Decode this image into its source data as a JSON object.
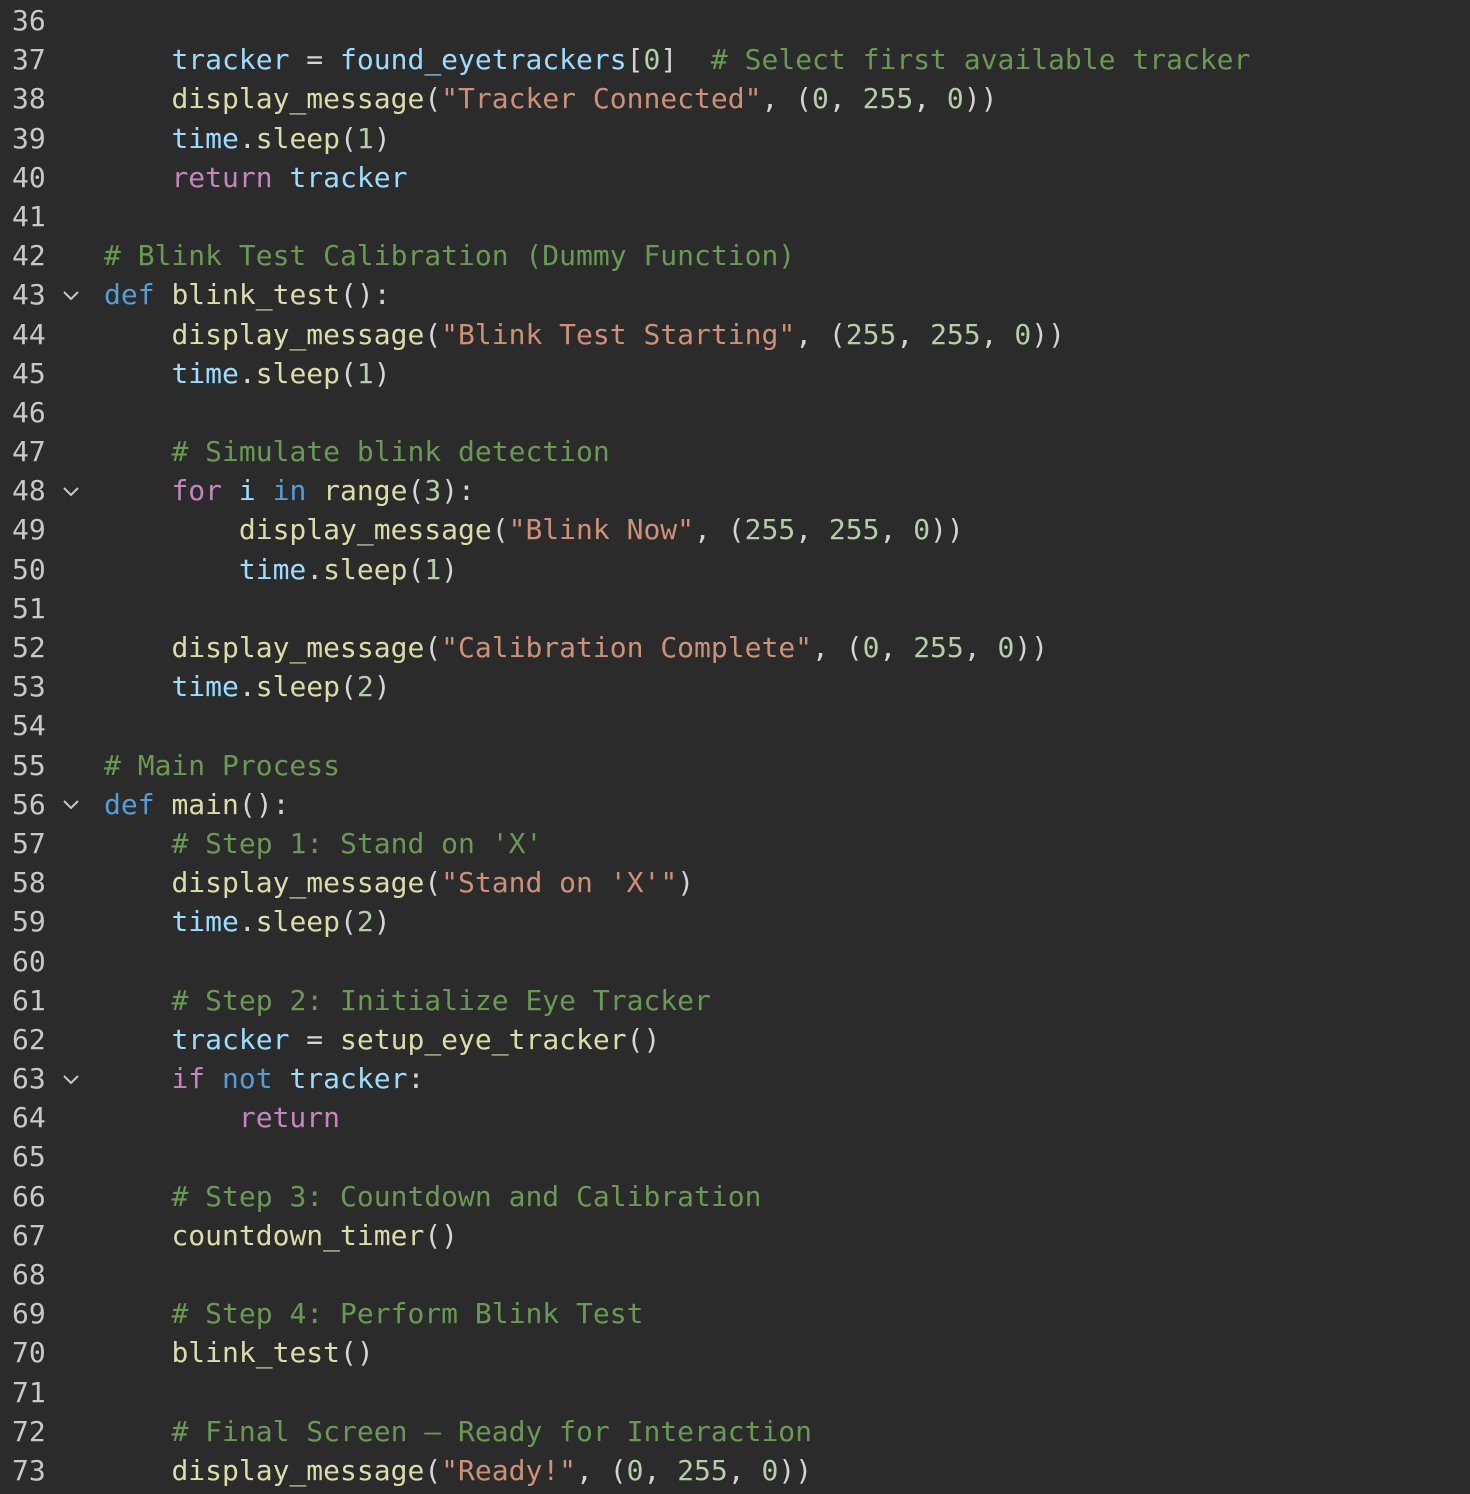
{
  "editor": {
    "language": "python",
    "theme": {
      "background": "#2b2b2b",
      "line_number": "#c8c8c8",
      "keyword": "#569cd6",
      "control": "#c586c0",
      "function": "#dcdcaa",
      "variable": "#9cdcfe",
      "string": "#ce9178",
      "number": "#b5cea8",
      "comment": "#6a9955",
      "plain": "#d4d4d4"
    },
    "fold_icon": "chevron-down-icon",
    "lines": [
      {
        "num": "36",
        "indent": 0,
        "fold": false,
        "tokens": []
      },
      {
        "num": "37",
        "indent": 1,
        "fold": false,
        "tokens": [
          [
            "var",
            "tracker"
          ],
          [
            "plain",
            " = "
          ],
          [
            "var",
            "found_eyetrackers"
          ],
          [
            "plain",
            "["
          ],
          [
            "num",
            "0"
          ],
          [
            "plain",
            "]  "
          ],
          [
            "com",
            "# Select first available tracker"
          ]
        ]
      },
      {
        "num": "38",
        "indent": 1,
        "fold": false,
        "tokens": [
          [
            "fn",
            "display_message"
          ],
          [
            "plain",
            "("
          ],
          [
            "str",
            "\"Tracker Connected\""
          ],
          [
            "plain",
            ", ("
          ],
          [
            "num",
            "0"
          ],
          [
            "plain",
            ", "
          ],
          [
            "num",
            "255"
          ],
          [
            "plain",
            ", "
          ],
          [
            "num",
            "0"
          ],
          [
            "plain",
            "))"
          ]
        ]
      },
      {
        "num": "39",
        "indent": 1,
        "fold": false,
        "tokens": [
          [
            "var",
            "time"
          ],
          [
            "plain",
            "."
          ],
          [
            "fn",
            "sleep"
          ],
          [
            "plain",
            "("
          ],
          [
            "num",
            "1"
          ],
          [
            "plain",
            ")"
          ]
        ]
      },
      {
        "num": "40",
        "indent": 1,
        "fold": false,
        "tokens": [
          [
            "ctrl",
            "return"
          ],
          [
            "plain",
            " "
          ],
          [
            "var",
            "tracker"
          ]
        ]
      },
      {
        "num": "41",
        "indent": 0,
        "fold": false,
        "tokens": []
      },
      {
        "num": "42",
        "indent": 0,
        "fold": false,
        "tokens": [
          [
            "com",
            "# Blink Test Calibration (Dummy Function)"
          ]
        ]
      },
      {
        "num": "43",
        "indent": 0,
        "fold": true,
        "tokens": [
          [
            "kw",
            "def"
          ],
          [
            "plain",
            " "
          ],
          [
            "fn",
            "blink_test"
          ],
          [
            "plain",
            "():"
          ]
        ]
      },
      {
        "num": "44",
        "indent": 1,
        "fold": false,
        "tokens": [
          [
            "fn",
            "display_message"
          ],
          [
            "plain",
            "("
          ],
          [
            "str",
            "\"Blink Test Starting\""
          ],
          [
            "plain",
            ", ("
          ],
          [
            "num",
            "255"
          ],
          [
            "plain",
            ", "
          ],
          [
            "num",
            "255"
          ],
          [
            "plain",
            ", "
          ],
          [
            "num",
            "0"
          ],
          [
            "plain",
            "))"
          ]
        ]
      },
      {
        "num": "45",
        "indent": 1,
        "fold": false,
        "tokens": [
          [
            "var",
            "time"
          ],
          [
            "plain",
            "."
          ],
          [
            "fn",
            "sleep"
          ],
          [
            "plain",
            "("
          ],
          [
            "num",
            "1"
          ],
          [
            "plain",
            ")"
          ]
        ]
      },
      {
        "num": "46",
        "indent": 0,
        "fold": false,
        "tokens": []
      },
      {
        "num": "47",
        "indent": 1,
        "fold": false,
        "tokens": [
          [
            "com",
            "# Simulate blink detection"
          ]
        ]
      },
      {
        "num": "48",
        "indent": 1,
        "fold": true,
        "tokens": [
          [
            "ctrl",
            "for"
          ],
          [
            "plain",
            " "
          ],
          [
            "var",
            "i"
          ],
          [
            "plain",
            " "
          ],
          [
            "kw",
            "in"
          ],
          [
            "plain",
            " "
          ],
          [
            "fn",
            "range"
          ],
          [
            "plain",
            "("
          ],
          [
            "num",
            "3"
          ],
          [
            "plain",
            "):"
          ]
        ]
      },
      {
        "num": "49",
        "indent": 2,
        "fold": false,
        "tokens": [
          [
            "fn",
            "display_message"
          ],
          [
            "plain",
            "("
          ],
          [
            "str",
            "\"Blink Now\""
          ],
          [
            "plain",
            ", ("
          ],
          [
            "num",
            "255"
          ],
          [
            "plain",
            ", "
          ],
          [
            "num",
            "255"
          ],
          [
            "plain",
            ", "
          ],
          [
            "num",
            "0"
          ],
          [
            "plain",
            "))"
          ]
        ]
      },
      {
        "num": "50",
        "indent": 2,
        "fold": false,
        "tokens": [
          [
            "var",
            "time"
          ],
          [
            "plain",
            "."
          ],
          [
            "fn",
            "sleep"
          ],
          [
            "plain",
            "("
          ],
          [
            "num",
            "1"
          ],
          [
            "plain",
            ")"
          ]
        ]
      },
      {
        "num": "51",
        "indent": 0,
        "fold": false,
        "tokens": []
      },
      {
        "num": "52",
        "indent": 1,
        "fold": false,
        "tokens": [
          [
            "fn",
            "display_message"
          ],
          [
            "plain",
            "("
          ],
          [
            "str",
            "\"Calibration Complete\""
          ],
          [
            "plain",
            ", ("
          ],
          [
            "num",
            "0"
          ],
          [
            "plain",
            ", "
          ],
          [
            "num",
            "255"
          ],
          [
            "plain",
            ", "
          ],
          [
            "num",
            "0"
          ],
          [
            "plain",
            "))"
          ]
        ]
      },
      {
        "num": "53",
        "indent": 1,
        "fold": false,
        "tokens": [
          [
            "var",
            "time"
          ],
          [
            "plain",
            "."
          ],
          [
            "fn",
            "sleep"
          ],
          [
            "plain",
            "("
          ],
          [
            "num",
            "2"
          ],
          [
            "plain",
            ")"
          ]
        ]
      },
      {
        "num": "54",
        "indent": 0,
        "fold": false,
        "tokens": []
      },
      {
        "num": "55",
        "indent": 0,
        "fold": false,
        "tokens": [
          [
            "com",
            "# Main Process"
          ]
        ]
      },
      {
        "num": "56",
        "indent": 0,
        "fold": true,
        "tokens": [
          [
            "kw",
            "def"
          ],
          [
            "plain",
            " "
          ],
          [
            "fn",
            "main"
          ],
          [
            "plain",
            "():"
          ]
        ]
      },
      {
        "num": "57",
        "indent": 1,
        "fold": false,
        "tokens": [
          [
            "com",
            "# Step 1: Stand on 'X'"
          ]
        ]
      },
      {
        "num": "58",
        "indent": 1,
        "fold": false,
        "tokens": [
          [
            "fn",
            "display_message"
          ],
          [
            "plain",
            "("
          ],
          [
            "str",
            "\"Stand on 'X'\""
          ],
          [
            "plain",
            ")"
          ]
        ]
      },
      {
        "num": "59",
        "indent": 1,
        "fold": false,
        "tokens": [
          [
            "var",
            "time"
          ],
          [
            "plain",
            "."
          ],
          [
            "fn",
            "sleep"
          ],
          [
            "plain",
            "("
          ],
          [
            "num",
            "2"
          ],
          [
            "plain",
            ")"
          ]
        ]
      },
      {
        "num": "60",
        "indent": 0,
        "fold": false,
        "tokens": []
      },
      {
        "num": "61",
        "indent": 1,
        "fold": false,
        "tokens": [
          [
            "com",
            "# Step 2: Initialize Eye Tracker"
          ]
        ]
      },
      {
        "num": "62",
        "indent": 1,
        "fold": false,
        "tokens": [
          [
            "var",
            "tracker"
          ],
          [
            "plain",
            " = "
          ],
          [
            "fn",
            "setup_eye_tracker"
          ],
          [
            "plain",
            "()"
          ]
        ]
      },
      {
        "num": "63",
        "indent": 1,
        "fold": true,
        "tokens": [
          [
            "ctrl",
            "if"
          ],
          [
            "plain",
            " "
          ],
          [
            "kw",
            "not"
          ],
          [
            "plain",
            " "
          ],
          [
            "var",
            "tracker"
          ],
          [
            "plain",
            ":"
          ]
        ]
      },
      {
        "num": "64",
        "indent": 2,
        "fold": false,
        "tokens": [
          [
            "ctrl",
            "return"
          ]
        ]
      },
      {
        "num": "65",
        "indent": 0,
        "fold": false,
        "tokens": []
      },
      {
        "num": "66",
        "indent": 1,
        "fold": false,
        "tokens": [
          [
            "com",
            "# Step 3: Countdown and Calibration"
          ]
        ]
      },
      {
        "num": "67",
        "indent": 1,
        "fold": false,
        "tokens": [
          [
            "fn",
            "countdown_timer"
          ],
          [
            "plain",
            "()"
          ]
        ]
      },
      {
        "num": "68",
        "indent": 0,
        "fold": false,
        "tokens": []
      },
      {
        "num": "69",
        "indent": 1,
        "fold": false,
        "tokens": [
          [
            "com",
            "# Step 4: Perform Blink Test"
          ]
        ]
      },
      {
        "num": "70",
        "indent": 1,
        "fold": false,
        "tokens": [
          [
            "fn",
            "blink_test"
          ],
          [
            "plain",
            "()"
          ]
        ]
      },
      {
        "num": "71",
        "indent": 0,
        "fold": false,
        "tokens": []
      },
      {
        "num": "72",
        "indent": 1,
        "fold": false,
        "tokens": [
          [
            "com",
            "# Final Screen – Ready for Interaction"
          ]
        ]
      },
      {
        "num": "73",
        "indent": 1,
        "fold": false,
        "tokens": [
          [
            "fn",
            "display_message"
          ],
          [
            "plain",
            "("
          ],
          [
            "str",
            "\"Ready!\""
          ],
          [
            "plain",
            ", ("
          ],
          [
            "num",
            "0"
          ],
          [
            "plain",
            ", "
          ],
          [
            "num",
            "255"
          ],
          [
            "plain",
            ", "
          ],
          [
            "num",
            "0"
          ],
          [
            "plain",
            "))"
          ]
        ]
      }
    ]
  }
}
